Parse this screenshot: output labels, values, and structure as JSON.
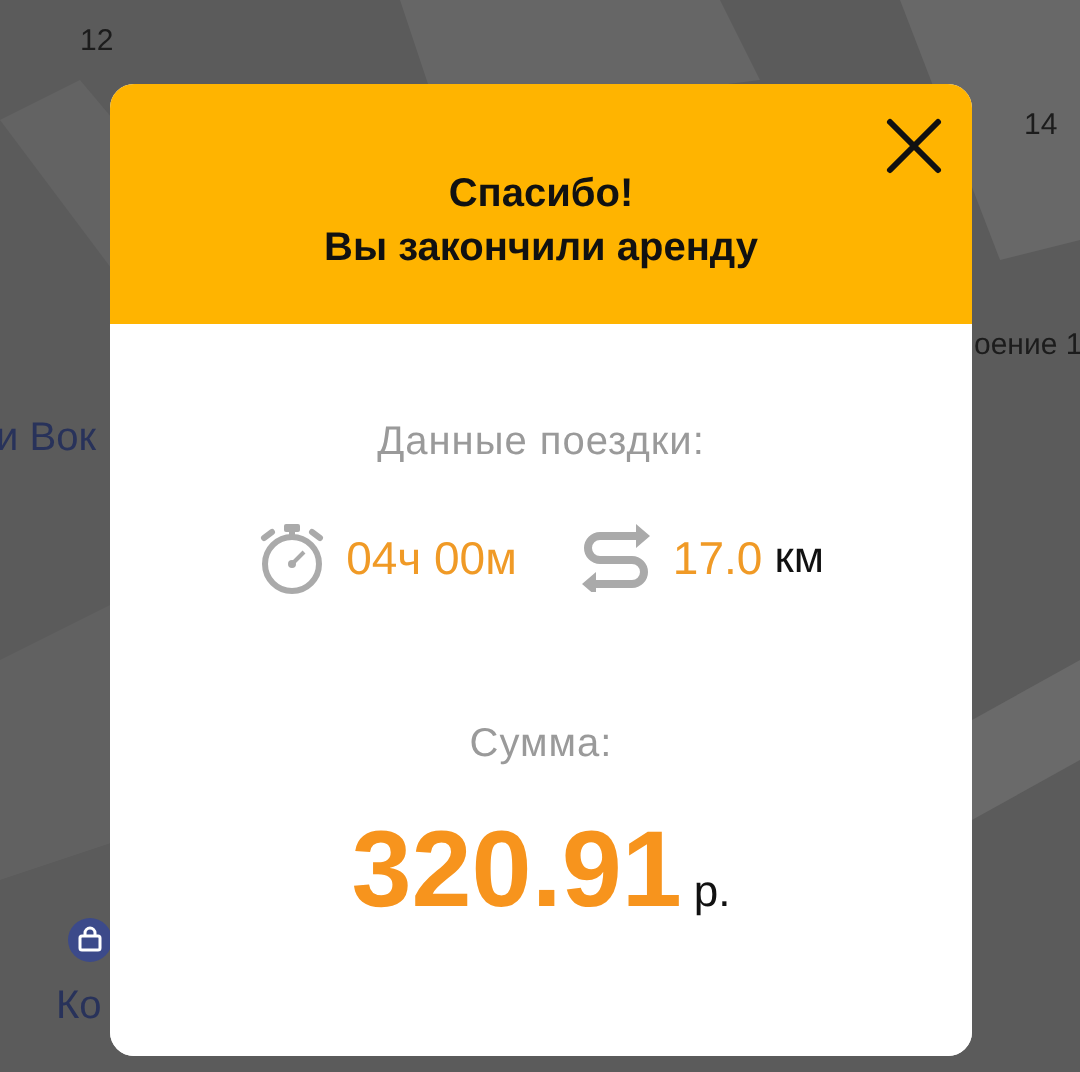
{
  "map": {
    "labels": [
      {
        "text": "12",
        "kind": "number"
      },
      {
        "text": "14",
        "kind": "number"
      },
      {
        "text": "оение 1",
        "kind": "number"
      },
      {
        "text": "и Вок",
        "kind": "place"
      },
      {
        "text": "Ко",
        "kind": "place"
      }
    ]
  },
  "dialog": {
    "title_lines": [
      "Спасибо!",
      "Вы закончили аренду"
    ],
    "trip_heading": "Данные поездки:",
    "duration": "04ч 00м",
    "distance": "17.0",
    "distance_unit": "км",
    "total_heading": "Сумма:",
    "total": "320.91",
    "currency": "р."
  }
}
